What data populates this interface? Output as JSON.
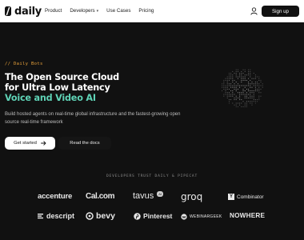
{
  "nav": {
    "brand": "daily",
    "links": [
      {
        "label": "Product",
        "has_chevron": false
      },
      {
        "label": "Developers",
        "has_chevron": true
      },
      {
        "label": "Use Cases",
        "has_chevron": false
      },
      {
        "label": "Pricing",
        "has_chevron": false
      }
    ],
    "user_icon": "user-icon",
    "signup_label": "Sign up"
  },
  "hero": {
    "kicker": "// Daily Bots",
    "title_line1": "The Open Source Cloud",
    "title_line2": "for Ultra Low Latency",
    "title_accent": "Voice and Video AI",
    "subtitle": "Build hosted agents on real-time global infrastructure and the fastest-growing open source real-time framework",
    "primary_cta": "Get started",
    "secondary_cta": "Read the docs",
    "accent_color": "#5fd3b6",
    "kicker_color": "#e8a13a",
    "graphic": "dotted-globe"
  },
  "trust": {
    "heading": "DEVELOPERS TRUST DAILY & PIPECAT",
    "logos": [
      {
        "name": "accenture",
        "text": "accenture"
      },
      {
        "name": "calcom",
        "text": "Cal.com"
      },
      {
        "name": "tavus",
        "text": "tavus",
        "badge": "AI"
      },
      {
        "name": "groq",
        "text": "groq"
      },
      {
        "name": "ycombinator",
        "text": "Combinator",
        "mark": "Y"
      },
      {
        "name": "descript",
        "text": "descript"
      },
      {
        "name": "bevy",
        "text": "bevy"
      },
      {
        "name": "pinterest",
        "text": "Pinterest"
      },
      {
        "name": "webinargeek",
        "text": "WEBINARGEEK"
      },
      {
        "name": "nowhere",
        "text": "NOWHERE"
      }
    ]
  }
}
